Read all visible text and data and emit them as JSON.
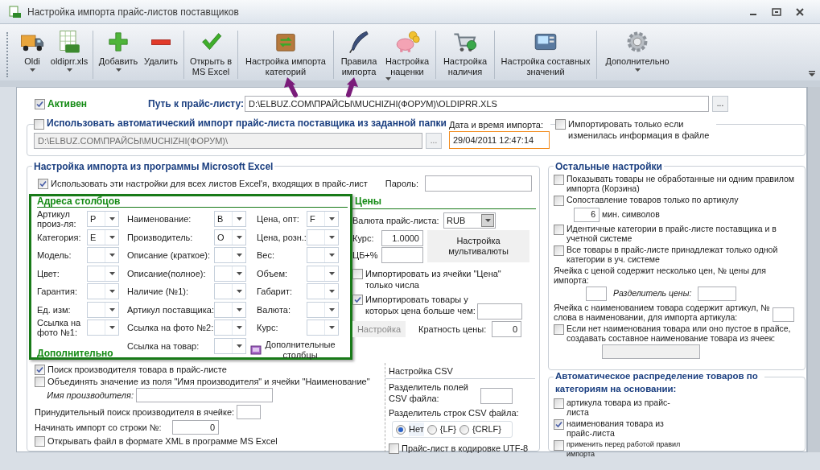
{
  "window": {
    "title": "Настройка импорта прайс-листов поставщиков"
  },
  "toolbar": [
    {
      "label": "Oldi",
      "kind": "truck",
      "dropdown": true
    },
    {
      "label": "oldiprr.xls",
      "kind": "sheet",
      "dropdown": true
    },
    {
      "label": "Добавить",
      "kind": "plus",
      "dropdown": true
    },
    {
      "label": "Удалить",
      "kind": "minus",
      "dropdown": false
    },
    {
      "label": "Открыть в\nMS Excel",
      "kind": "check",
      "dropdown": false
    },
    {
      "label": "Настройка импорта\nкатегорий",
      "kind": "box",
      "dropdown": false
    },
    {
      "label": "Правила\nимпорта",
      "kind": "feather",
      "dropdown": false
    },
    {
      "label": "Настройка\nнаценки",
      "kind": "pig",
      "dropdown": true
    },
    {
      "label": "Настройка\nналичия",
      "kind": "cart",
      "dropdown": false
    },
    {
      "label": "Настройка составных\nзначений",
      "kind": "device",
      "dropdown": false
    },
    {
      "label": "Дополнительно",
      "kind": "gear",
      "dropdown": true
    }
  ],
  "active": {
    "label": "Активен",
    "checked": true
  },
  "path": {
    "label": "Путь к прайс-листу:",
    "value": "D:\\ELBUZ.COM\\ПРАЙСЫ\\MUCHIZHI(ФОРУМ)\\OLDIPRR.XLS",
    "browse": "..."
  },
  "auto_import": {
    "label": "Использовать автоматический импорт прайс-листа поставщика из заданной папки",
    "checked": false,
    "folder": "D:\\ELBUZ.COM\\ПРАЙСЫ\\MUCHIZHI(ФОРУМ)\\",
    "browse": "...",
    "date_label": "Дата и время импорта:",
    "date_value": "29/04/2011 12:47:14",
    "only_changed": {
      "label": "Импортировать только если изменилась информация в файле",
      "checked": false
    }
  },
  "excel": {
    "title": "Настройка импорта из программы Microsoft Excel",
    "use_all_sheets": {
      "label": "Использовать эти настройки для всех листов Excel'я, входящих в прайс-лист",
      "checked": true
    },
    "password_label": "Пароль:",
    "columns_title": "Адреса столбцов",
    "columns": [
      [
        {
          "label": "Артикул произ-ля:",
          "value": "P"
        },
        {
          "label": "Категория:",
          "value": "E"
        },
        {
          "label": "Модель:"
        },
        {
          "label": "Цвет:"
        },
        {
          "label": "Гарантия:"
        },
        {
          "label": "Ед. изм:"
        },
        {
          "label": "Ссылка на фото №1:"
        }
      ],
      [
        {
          "label": "Наименование:",
          "value": "B"
        },
        {
          "label": "Производитель:",
          "value": "O"
        },
        {
          "label": "Описание (краткое):"
        },
        {
          "label": "Описание(полное):"
        },
        {
          "label": "Наличие (№1):"
        },
        {
          "label": "Артикул поставщика:"
        },
        {
          "label": "Ссылка на фото №2:"
        },
        {
          "label": "Ссылка на товар:"
        }
      ],
      [
        {
          "label": "Цена, опт:",
          "value": "F"
        },
        {
          "label": "Цена, розн.:"
        },
        {
          "label": "Вес:"
        },
        {
          "label": "Объем:"
        },
        {
          "label": "Габарит:"
        },
        {
          "label": "Валюта:"
        },
        {
          "label": "Курс:"
        }
      ]
    ],
    "extra_columns": "Дополнительные столбцы",
    "additional_title": "Дополнительно",
    "prices": {
      "title": "Цены",
      "currency_label": "Валюта прайс-листа:",
      "currency": "RUB",
      "rate_label": "Курс:",
      "rate": "1.0000",
      "cb_label": "ЦБ+%",
      "multi_button": "Настройка мультивалюты",
      "numbers_only": {
        "label": "Импортировать из ячейки \"Цена\" только числа",
        "checked": false
      },
      "min_price": {
        "label": "Импортировать товары у которых цена больше чем:",
        "checked": true
      },
      "settings_button": {
        "label": "Настройка",
        "disabled": true
      },
      "multiplicity_label": "Кратность цены:",
      "multiplicity": "0"
    },
    "additional": [
      {
        "kind": "checkbox",
        "label": "Поиск производителя товара в прайс-листе",
        "checked": true
      },
      {
        "kind": "checkbox",
        "label": "Объединять значение из поля \"Имя производителя\" и ячейки \"Наименование\"",
        "checked": false
      },
      {
        "kind": "subfield",
        "label": "Имя производителя:"
      },
      {
        "kind": "smallfield",
        "label": "Принудительный поиск производителя в ячейке:"
      },
      {
        "kind": "field",
        "label": "Начинать импорт со строки №:",
        "value": "0"
      },
      {
        "kind": "checkbox",
        "label": "Открывать файл в формате XML в программе MS Excel",
        "checked": false
      }
    ],
    "csv": {
      "title": "Настройка CSV",
      "field_sep_label": "Разделитель полей CSV файла:",
      "row_sep_label": "Разделитель строк CSV файла:",
      "row_sep_options": [
        {
          "label": "Нет",
          "selected": true
        },
        {
          "label": "{LF}",
          "selected": false
        },
        {
          "label": "{CRLF}",
          "selected": false
        }
      ],
      "utf8": {
        "label": "Прайс-лист в кодировке UTF-8",
        "checked": false
      }
    }
  },
  "other": {
    "title": "Остальные настройки",
    "show_basket": {
      "label": "Показывать товары не обработанные ни одним правилом импорта (Корзина)",
      "checked": false
    },
    "match_by_article": {
      "label": "Сопоставление товаров только по артикулу",
      "checked": false
    },
    "min_chars": "6",
    "min_chars_label": "мин. символов",
    "identical_categories": {
      "label": "Идентичные категории в прайс-листе поставщика и в учетной системе",
      "checked": false
    },
    "single_category": {
      "label": "Все товары в прайс-листе принадлежат только одной категории в уч. системе",
      "checked": false
    },
    "multi_price_label": "Ячейка с ценой содержит несколько цен, № цены для импорта:",
    "price_sep_label": "Разделитель цены:",
    "article_word_label": "Ячейка с наименованием товара содержит артикул, № слова в наименовании, для импорта артикула:",
    "composite": {
      "label": "Если нет наименования товара или оно пустое в прайсе, создавать составное наименование товара из ячеек:",
      "checked": false
    }
  },
  "auto_category": {
    "title": "Автоматическое распределение товаров по категориям на основании:",
    "items": [
      {
        "label": "артикула товара из прайс-листа",
        "checked": false,
        "small": false
      },
      {
        "label": "наименования товара из прайс-листа",
        "checked": true,
        "small": false
      },
      {
        "label": "применить перед работой правил импорта",
        "checked": false,
        "small": true
      }
    ]
  }
}
